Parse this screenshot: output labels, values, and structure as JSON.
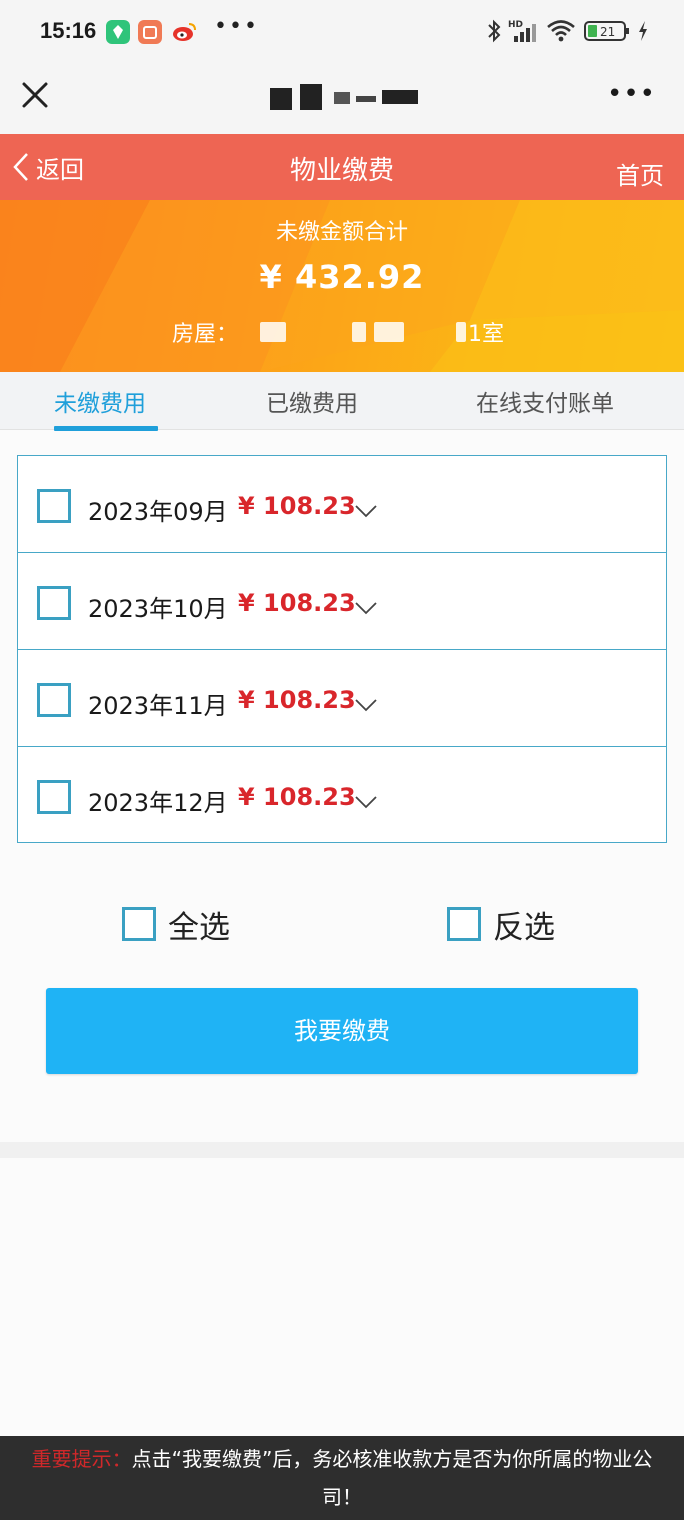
{
  "status_bar": {
    "time": "15:16",
    "dots": "•••",
    "network": "HD",
    "battery": "21",
    "app_icons": [
      {
        "name": "green-app-icon",
        "color": "#2fc47a"
      },
      {
        "name": "red-app-icon",
        "color": "#f07a55"
      },
      {
        "name": "weibo-icon",
        "color": "#f5c400"
      }
    ]
  },
  "title_bar": {
    "close_icon": "close-icon",
    "more_label": "•••"
  },
  "header": {
    "back_label": "返回",
    "title": "物业缴费",
    "home_label": "首页",
    "color": "#ee6553"
  },
  "summary": {
    "label": "未缴金额合计",
    "amount": "¥ 432.92",
    "house_label": "房屋：",
    "house_suffix": "1室"
  },
  "tabs": [
    {
      "label": "未缴费用",
      "active": true
    },
    {
      "label": "已缴费用",
      "active": false
    },
    {
      "label": "在线支付账单",
      "active": false
    }
  ],
  "bills": [
    {
      "month": "2023年09月",
      "amount": "¥ 108.23"
    },
    {
      "month": "2023年10月",
      "amount": "¥ 108.23"
    },
    {
      "month": "2023年11月",
      "amount": "¥ 108.23"
    },
    {
      "month": "2023年12月",
      "amount": "¥ 108.23"
    }
  ],
  "controls": {
    "select_all": "全选",
    "invert": "反选",
    "pay_button": "我要缴费"
  },
  "notice": {
    "label": "重要提示：",
    "text": "点击“我要缴费”后，务必核准收款方是否为你所属的物业公司！"
  },
  "colors": {
    "accent_blue": "#1fb3f5",
    "tab_active": "#1f9fda",
    "amount_red": "#d9262b",
    "banner_orange": "#fd9d18"
  }
}
